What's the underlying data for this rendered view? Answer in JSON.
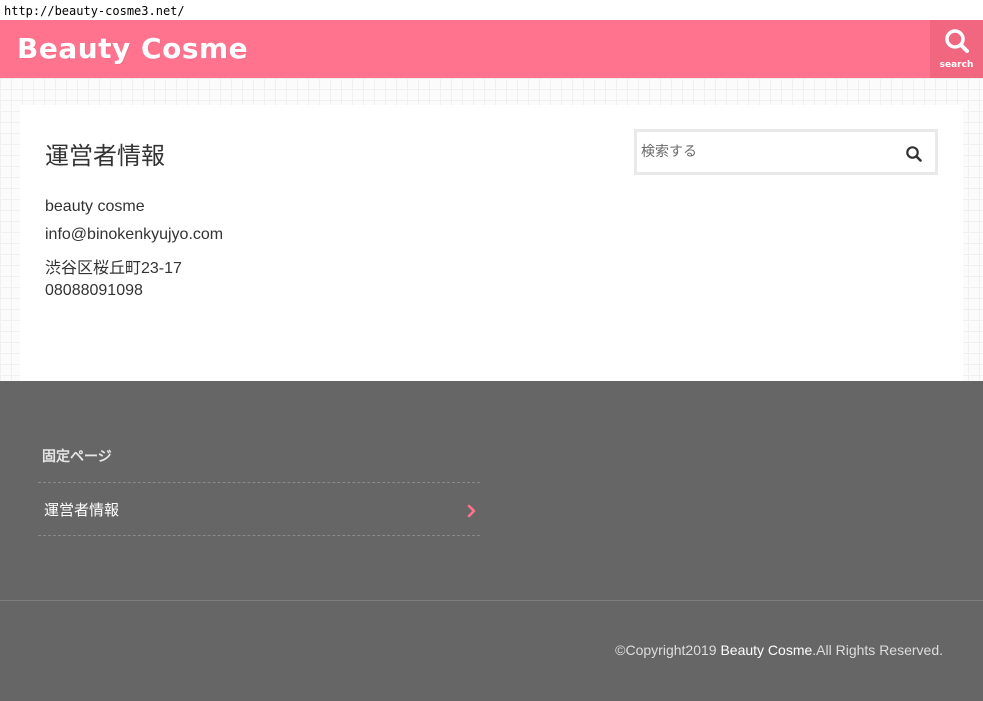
{
  "browser": {
    "url": "http://beauty-cosme3.net/"
  },
  "header": {
    "site_title": "Beauty Cosme",
    "search_label": "search",
    "bg_color": "#ff738f"
  },
  "main": {
    "page_title": "運営者情報",
    "info_lines": [
      "beauty cosme",
      "info@binokenkyujyo.com",
      "渋谷区桜丘町23-17",
      "08088091098"
    ],
    "search": {
      "placeholder": "検索する",
      "value": ""
    }
  },
  "footer": {
    "widget_title": "固定ページ",
    "pages": [
      {
        "label": "運営者情報"
      }
    ],
    "copyright_prefix": "©Copyright2019 ",
    "copyright_brand": "Beauty Cosme",
    "copyright_suffix": ".All Rights Reserved.",
    "bg_color": "#666666",
    "accent": "#ff738f"
  },
  "icons": [
    "search-icon",
    "chevron-right-icon"
  ]
}
